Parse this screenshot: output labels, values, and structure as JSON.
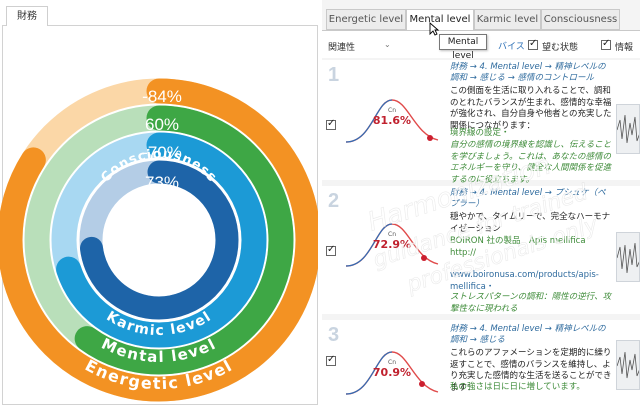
{
  "left_panel": {
    "tab_label": "財務",
    "rings": [
      {
        "value_label": "-84%",
        "name": "Energetic level",
        "fraction": 0.84,
        "color": "#f39223",
        "light": "#fbd7a7"
      },
      {
        "value_label": "60%",
        "name": "Mental level",
        "fraction": 0.6,
        "color": "#3ea745",
        "light": "#b9dfba"
      },
      {
        "value_label": "-70%",
        "name": "Karmic level",
        "fraction": 0.7,
        "color": "#1c9ad6",
        "light": "#a8d8f2"
      },
      {
        "value_label": "73%",
        "name": "Consciousness",
        "fraction": 0.73,
        "color": "#1e64a8",
        "light": "#b4cde6"
      }
    ]
  },
  "right_panel": {
    "tabs": [
      {
        "label": "Energetic level",
        "active": false
      },
      {
        "label": "Mental level",
        "active": true
      },
      {
        "label": "Karmic level",
        "active": false
      },
      {
        "label": "Consciousness",
        "active": false
      }
    ],
    "tooltip": "Mental level",
    "toolbar": {
      "sort_label": "関連性",
      "advice_label": "バイス",
      "desired_state_label": "望む状態",
      "info_label": "情報"
    },
    "items": [
      {
        "number": "1",
        "checked": true,
        "percent": "81.6%",
        "cn_label": "Cn",
        "path": "財務 → 4. Mental level → 精神レベルの調和 → 感じる → 感情のコントロール",
        "text": "この側面を生活に取り入れることで、調和のとれたバランスが生まれ、感情的な幸福が強化され、自分自身や他者との充実した関係につながります：",
        "green_heading": "境界線の設定・",
        "green_text": "自分の感情の境界線を認識し、伝えることを学びましょう。これは、あなたの感情のエネルギーを守り、健全な人間関係を促進するのに役立ちます。"
      },
      {
        "number": "2",
        "checked": true,
        "percent": "72.9%",
        "cn_label": "Cn",
        "path": "財務 → 4. Mental level → プシュケ（ペプラー）",
        "text": "穏やかで、タイムリーで、完全なハーモナイゼーション",
        "green_heading": "BOIRON 社の製品　Apis mellifica　http://",
        "link": "www.boironusa.com/products/apis-mellifica・",
        "green_text": "ストレスパターンの調和：陽性の逆行、攻撃性なに現われる"
      },
      {
        "number": "3",
        "checked": true,
        "percent": "70.9%",
        "cn_label": "Cn",
        "path": "財務 → 4. Mental level → 精神レベルの調和 → 感じる",
        "text": "これらのアファメーションを定期的に繰り返すことで、感情のバランスを維持し、より充実した感情的な生活を送ることができます：",
        "green_heading": "私の強さは日に日に増しています。"
      }
    ]
  },
  "watermark": {
    "line1": "Harmonization",
    "line2": "guidance for trained",
    "line3": "professionals only"
  }
}
